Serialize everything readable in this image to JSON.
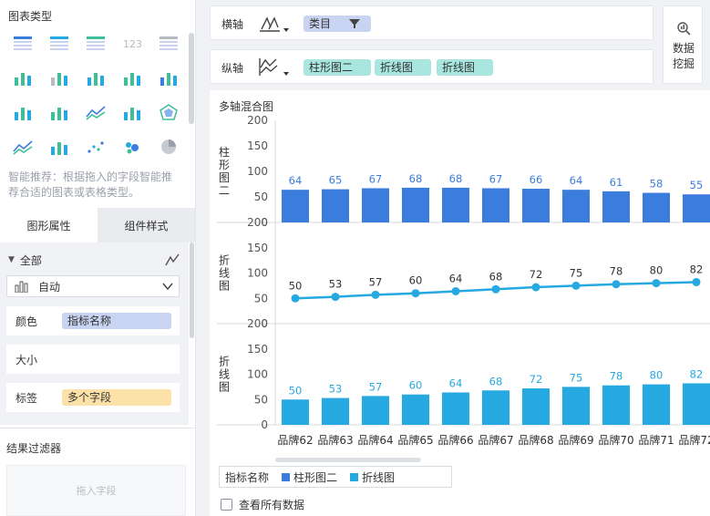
{
  "left": {
    "chart_types_title": "图表类型",
    "chart_type_icons": [
      "cross-table-icon",
      "group-table-icon",
      "detail-table-icon",
      "kpi-number-icon",
      "text-table-icon",
      "scatter-matrix-icon",
      "map-icon",
      "stacked-bar-icon",
      "column-chart-icon",
      "grouped-column-icon",
      "horizontal-bar-icon",
      "waterfall-icon",
      "line-chart-icon",
      "combo-line-icon",
      "radar-icon",
      "area-chart-icon",
      "combo-chart-icon",
      "scatter-icon",
      "bubble-icon",
      "pie-icon"
    ],
    "smart_hint": "智能推荐：根据拖入的字段智能推荐合适的图表或表格类型。",
    "tabs": [
      "图形属性",
      "组件样式"
    ],
    "all_label": "全部",
    "auto_select": "自动",
    "props": [
      {
        "label": "颜色",
        "pill": "指标名称",
        "pill_color": "#c9d3f2"
      },
      {
        "label": "大小",
        "pill": "",
        "pill_color": ""
      },
      {
        "label": "标签",
        "pill": "多个字段",
        "pill_color": "#fce2a8"
      }
    ],
    "filter_title": "结果过滤器",
    "drop_zone": "拖入字段"
  },
  "shelves": {
    "x_label": "横轴",
    "x_fields": [
      {
        "name": "类目",
        "color": "#c9d3f2",
        "filter": true
      }
    ],
    "y_label": "纵轴",
    "y_fields": [
      {
        "name": "柱形图二",
        "color": "#a8e6df"
      },
      {
        "name": "折线图",
        "color": "#a8e6df"
      },
      {
        "name": "折线图",
        "color": "#a8e6df"
      }
    ]
  },
  "mining": {
    "label_line1": "数据",
    "label_line2": "挖掘"
  },
  "chart_title": "多轴混合图",
  "chart_data": {
    "type": "bar",
    "categories": [
      "品牌62",
      "品牌63",
      "品牌64",
      "品牌65",
      "品牌66",
      "品牌67",
      "品牌68",
      "品牌69",
      "品牌70",
      "品牌71",
      "品牌72"
    ],
    "panels": [
      {
        "axis_label": "柱形图二",
        "type": "bar",
        "color": "#3b7ddd",
        "values": [
          64,
          65,
          67,
          68,
          68,
          67,
          66,
          64,
          61,
          58,
          55
        ],
        "ylim": [
          0,
          200
        ],
        "ticks": [
          0,
          50,
          100,
          150,
          200
        ]
      },
      {
        "axis_label": "折线图",
        "type": "line",
        "color": "#26a8e0",
        "values": [
          50,
          53,
          57,
          60,
          64,
          68,
          72,
          75,
          78,
          80,
          82
        ],
        "ylim": [
          0,
          200
        ],
        "ticks": [
          0,
          50,
          100,
          150,
          200
        ]
      },
      {
        "axis_label": "折线图",
        "type": "bar",
        "color": "#26a8e0",
        "values": [
          50,
          53,
          57,
          60,
          64,
          68,
          72,
          75,
          78,
          80,
          82
        ],
        "ylim": [
          0,
          200
        ],
        "ticks": [
          0,
          50,
          100,
          150,
          200
        ]
      }
    ],
    "legend": {
      "title": "指标名称",
      "items": [
        {
          "name": "柱形图二",
          "color": "#3b7ddd"
        },
        {
          "name": "折线图",
          "color": "#26a8e0"
        }
      ]
    }
  },
  "view_all_label": "查看所有数据"
}
